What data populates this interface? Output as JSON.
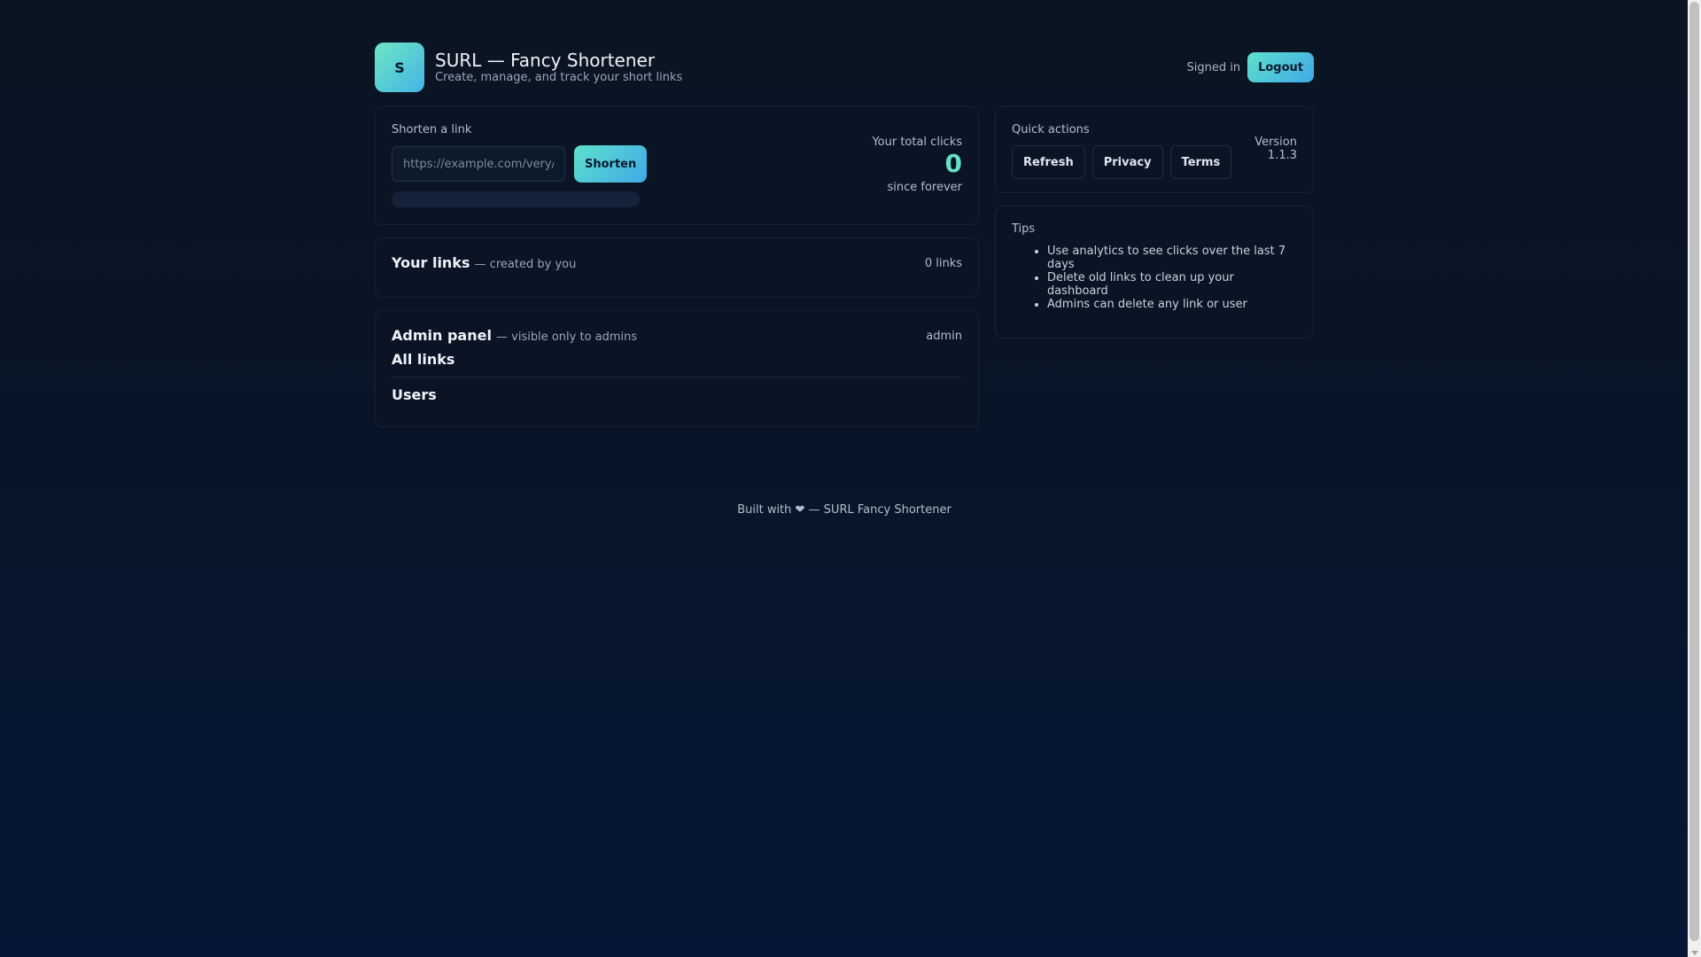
{
  "header": {
    "logo_letter": "S",
    "title": "SURL — Fancy Shortener",
    "subtitle": "Create, manage, and track your short links",
    "signed_in": "Signed in",
    "logout_label": "Logout"
  },
  "shorten": {
    "label": "Shorten a link",
    "placeholder": "https://example.com/very/long/url",
    "button_label": "Shorten",
    "clicks_label": "Your total clicks",
    "clicks_value": "0",
    "clicks_sub": "since forever"
  },
  "links": {
    "title": "Your links",
    "subtitle": "— created by you",
    "count": "0 links"
  },
  "admin": {
    "title": "Admin panel",
    "subtitle": "— visible only to admins",
    "role": "admin",
    "all_links": "All links",
    "users": "Users"
  },
  "footer": {
    "text": "Built with ❤ — SURL Fancy Shortener"
  },
  "quick_actions": {
    "label": "Quick actions",
    "refresh": "Refresh",
    "privacy": "Privacy",
    "terms": "Terms",
    "version_label": "Version",
    "version_value": "1.1.3"
  },
  "tips": {
    "label": "Tips",
    "items": [
      "Use analytics to see clicks over the last 7 days",
      "Delete old links to clean up your dashboard",
      "Admins can delete any link or user"
    ]
  },
  "colors": {
    "accent": "#66e0c6",
    "button_gradient_start": "#5ee0cc",
    "button_gradient_end": "#3fa9e8"
  }
}
